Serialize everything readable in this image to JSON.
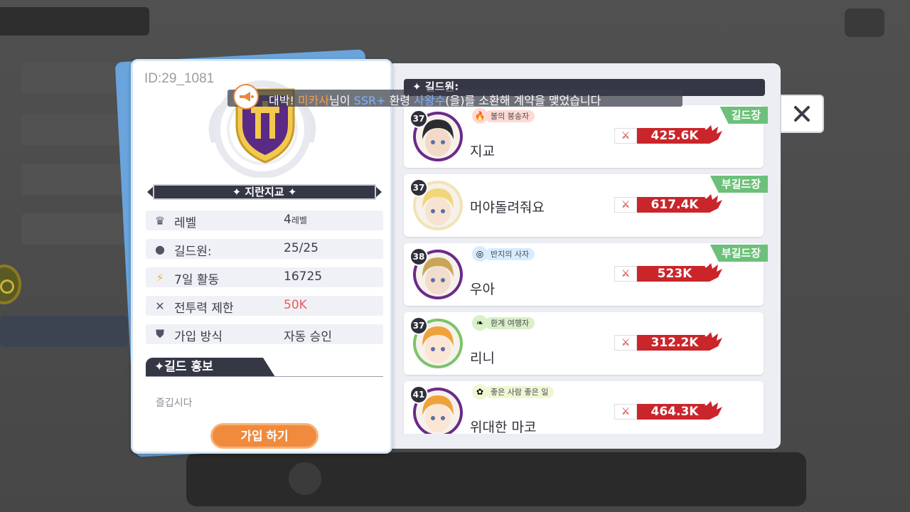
{
  "guild": {
    "id": "ID:29_1081",
    "name": "지란지교",
    "stats": [
      {
        "icon": "crown-icon",
        "label": "레벨",
        "value": "4",
        "suffix": "레벨",
        "highlight": false
      },
      {
        "icon": "person-icon",
        "label": "길드원:",
        "value": "25/25",
        "suffix": "",
        "highlight": false
      },
      {
        "icon": "lightning-icon",
        "label": "7일 활동",
        "value": "16725",
        "suffix": "",
        "highlight": false
      },
      {
        "icon": "crossed-swords-icon",
        "label": "전투력 제한",
        "value": "50K",
        "suffix": "",
        "highlight": true
      },
      {
        "icon": "shield-check-icon",
        "label": "가입 방식",
        "value": "자동 승인",
        "suffix": "",
        "highlight": false
      }
    ],
    "promo_title": "✦길드 홍보",
    "promo_text": "즐깁시다",
    "join_button": "가입 하기"
  },
  "members_header": "✦ 길드원:",
  "members": [
    {
      "level": "37",
      "name": "지교",
      "title": "불의 봉송자",
      "title_icon": "torch-icon",
      "title_color": "#ffd9d2",
      "power": "425.6K",
      "role": "길드장",
      "avatar_hair": "#2b2b30",
      "avatar_skin": "#f3d9c8",
      "avatar_ring": "#6b2a8a"
    },
    {
      "level": "37",
      "name": "머야돌려줘요",
      "title": "",
      "title_icon": "",
      "title_color": "",
      "power": "617.4K",
      "role": "부길드장",
      "avatar_hair": "#f2d77a",
      "avatar_skin": "#f7e3d2",
      "avatar_ring": "#f2e3b6"
    },
    {
      "level": "38",
      "name": "우아",
      "title": "반지의 사자",
      "title_icon": "ring-icon",
      "title_color": "#d6ecff",
      "power": "523K",
      "role": "부길드장",
      "avatar_hair": "#c9a55a",
      "avatar_skin": "#f2dccb",
      "avatar_ring": "#6b2a8a"
    },
    {
      "level": "37",
      "name": "리니",
      "title": "환계 여행자",
      "title_icon": "leaf-icon",
      "title_color": "#d9f0c8",
      "power": "312.2K",
      "role": "",
      "avatar_hair": "#f0a23a",
      "avatar_skin": "#fbe5d4",
      "avatar_ring": "#7cc46a"
    },
    {
      "level": "41",
      "name": "위대한 마코",
      "title": "좋은 사람 좋은 일",
      "title_icon": "sunflower-icon",
      "title_color": "#eef7d2",
      "power": "464.3K",
      "role": "",
      "avatar_hair": "#f0a23a",
      "avatar_skin": "#fbe5d4",
      "avatar_ring": "#6b2a8a"
    }
  ],
  "notification": {
    "prefix": "대박! ",
    "player": "미카사",
    "mid1": "님이 ",
    "rarity": "SSR+",
    "mid2": " 환령 ",
    "spirit": "사왕수",
    "suffix": "(을)를 소환해 계약을 맺었습니다"
  },
  "colors": {
    "accent_orange": "#f08a3c",
    "power_red": "#c9252a",
    "role_green": "#6cc07a",
    "dark_banner": "#353745"
  }
}
